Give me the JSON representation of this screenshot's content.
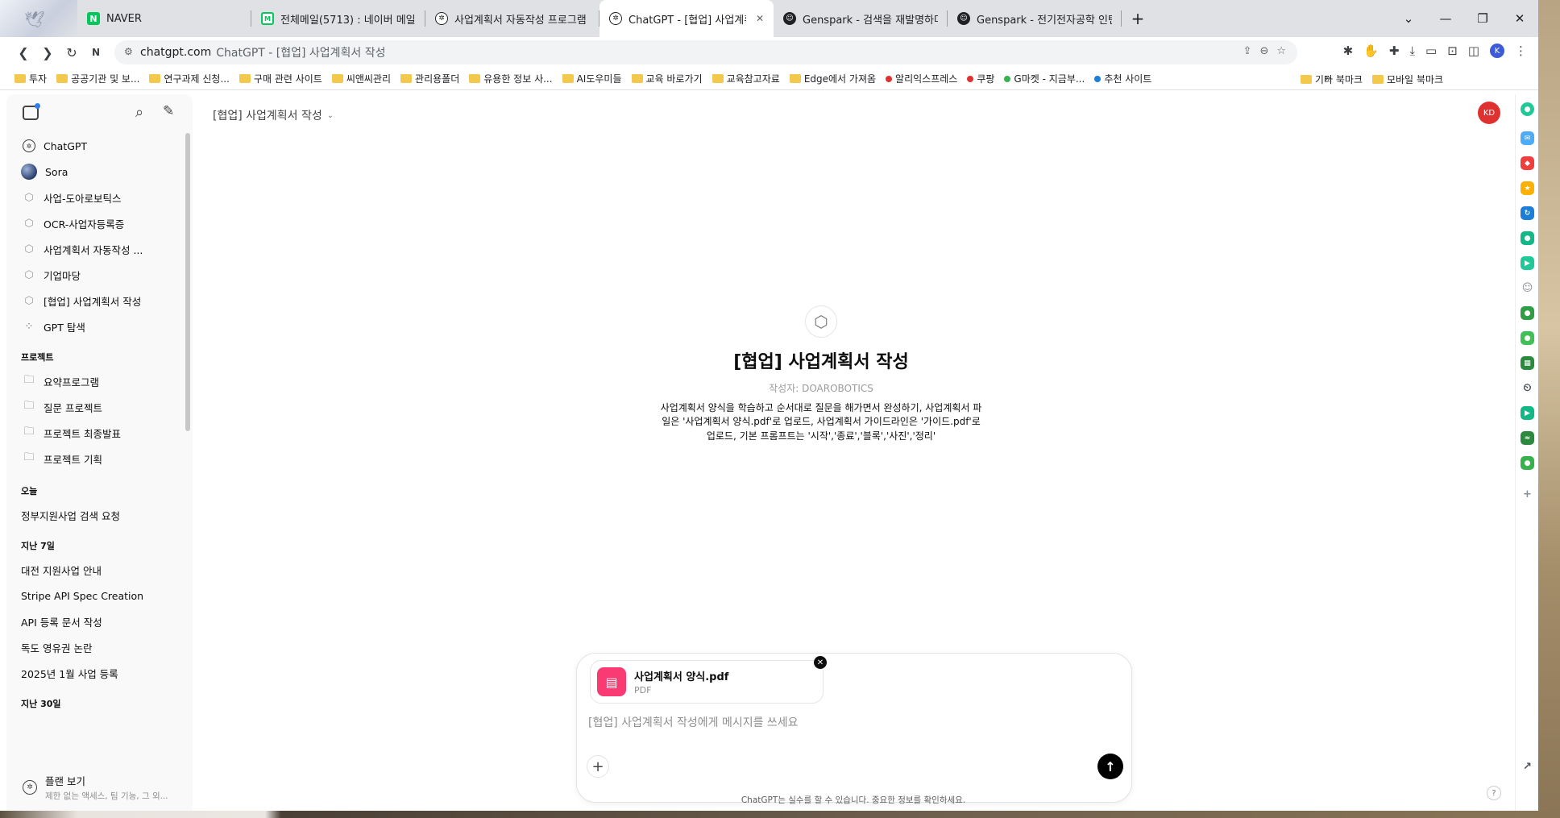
{
  "browser": {
    "tabs": [
      {
        "label": "NAVER",
        "favicon": "naver-icon",
        "active": false
      },
      {
        "label": "전체메일(5713) : 네이버 메일",
        "favicon": "mail-icon",
        "active": false
      },
      {
        "label": "사업계획서 자동작성 프로그램",
        "favicon": "chatgpt-icon",
        "active": false
      },
      {
        "label": "ChatGPT - [협업] 사업계획서",
        "favicon": "chatgpt-icon",
        "active": true
      },
      {
        "label": "Genspark - 검색을 재발명하다",
        "favicon": "genspark-icon",
        "active": false
      },
      {
        "label": "Genspark - 전기전자공학 인텐",
        "favicon": "genspark-icon",
        "active": false
      }
    ],
    "address": {
      "host": "chatgpt.com",
      "page_title": "ChatGPT - [협업] 사업계획서 작성"
    },
    "profile_initial": "K",
    "bookmarks": [
      {
        "label": "투자",
        "kind": "folder"
      },
      {
        "label": "공공기관 및 보...",
        "kind": "folder"
      },
      {
        "label": "연구과제 신청...",
        "kind": "folder"
      },
      {
        "label": "구매 관련 사이트",
        "kind": "folder"
      },
      {
        "label": "씨앤씨관리",
        "kind": "folder"
      },
      {
        "label": "관리용폴더",
        "kind": "folder"
      },
      {
        "label": "유용한 정보 사...",
        "kind": "folder"
      },
      {
        "label": "AI도우미들",
        "kind": "folder"
      },
      {
        "label": "교육 바로가기",
        "kind": "folder"
      },
      {
        "label": "교육참고자료",
        "kind": "folder"
      },
      {
        "label": "Edge에서 가져옴",
        "kind": "folder"
      },
      {
        "label": "알리익스프레스",
        "kind": "site",
        "color": "#e03131"
      },
      {
        "label": "쿠팡",
        "kind": "site",
        "color": "#e03131"
      },
      {
        "label": "G마켓 - 지금부...",
        "kind": "site",
        "color": "#37b24d"
      },
      {
        "label": "추천 사이트",
        "kind": "site",
        "color": "#1c7ed6"
      }
    ],
    "bookmarks_more": "»",
    "bookmarks_right": [
      {
        "label": "기타 북마크"
      },
      {
        "label": "모바일 북마크"
      }
    ]
  },
  "sidebar": {
    "items": [
      {
        "label": "ChatGPT",
        "icon": "chatgpt-icon"
      },
      {
        "label": "Sora",
        "icon": "sora-icon"
      },
      {
        "label": "사업-도아로보틱스",
        "icon": "cube-icon"
      },
      {
        "label": "OCR-사업자등록증",
        "icon": "cube-icon"
      },
      {
        "label": "사업계획서 자동작성 ...",
        "icon": "cube-icon"
      },
      {
        "label": "기업마당",
        "icon": "cube-icon"
      },
      {
        "label": "[협업] 사업계획서 작성",
        "icon": "cube-icon"
      },
      {
        "label": "GPT 탐색",
        "icon": "grid-icon"
      }
    ],
    "projects_title": "프로젝트",
    "projects": [
      {
        "label": "요약프로그램"
      },
      {
        "label": "질문 프로젝트"
      },
      {
        "label": "프로젝트 최종발표"
      },
      {
        "label": "프로젝트 기획"
      }
    ],
    "today_title": "오늘",
    "today": [
      {
        "label": "정부지원사업 검색 요청"
      }
    ],
    "week_title": "지난 7일",
    "week": [
      {
        "label": "대전 지원사업 안내"
      },
      {
        "label": "Stripe API Spec Creation"
      },
      {
        "label": "API 등록 문서 작성"
      },
      {
        "label": "독도 영유권 논란"
      },
      {
        "label": "2025년 1월 사업 등록"
      }
    ],
    "month_title": "지난 30일",
    "plan": {
      "title": "플랜 보기",
      "subtitle": "제한 없는 액세스, 팀 기능, 그 외..."
    }
  },
  "main": {
    "gpt_selector": "[협업] 사업계획서 작성",
    "avatar_initials": "KD",
    "hero": {
      "title": "[협업] 사업계획서 작성",
      "author": "작성자: DOAROBOTICS",
      "description": "사업계획서 양식을 학습하고 순서대로 질문을 해가면서 완성하기, 사업계획서 파일은 '사업계획서 양식.pdf'로 업로드, 사업계획서 가이드라인은 '가이드.pdf'로 업로드, 기본 프롬프트는 '시작','종료','블록','사진','정리'"
    },
    "composer": {
      "file_name": "사업계획서 양식.pdf",
      "file_type": "PDF",
      "placeholder": "[협업] 사업계획서 작성에게 메시지를 쓰세요"
    },
    "disclaimer": "ChatGPT는 실수를 할 수 있습니다. 중요한 정보를 확인하세요.",
    "help": "?"
  },
  "rail_icons": [
    {
      "name": "copilot-icon",
      "color": "#20c997"
    },
    {
      "name": "outlook-icon",
      "color": "#4dabf7"
    },
    {
      "name": "pocket-icon",
      "color": "#f03e3e"
    },
    {
      "name": "favorites-icon",
      "color": "#fab005"
    },
    {
      "name": "translate-icon",
      "color": "#1c7ed6"
    },
    {
      "name": "naver-app-icon",
      "color": "#12b886"
    },
    {
      "name": "media-icon",
      "color": "#20c997"
    },
    {
      "name": "bot-icon",
      "color": "#868e96"
    },
    {
      "name": "phone-icon",
      "color": "#2f9e44"
    },
    {
      "name": "whale-icon",
      "color": "#40c057"
    },
    {
      "name": "calendar-icon",
      "color": "#2b8a3e"
    },
    {
      "name": "clock-icon",
      "color": "#495057"
    },
    {
      "name": "play-icon",
      "color": "#12b886"
    },
    {
      "name": "stock-icon",
      "color": "#2b8a3e"
    },
    {
      "name": "store-icon",
      "color": "#37b24d"
    },
    {
      "name": "add-icon",
      "color": "#868e96"
    },
    {
      "name": "external-link-icon",
      "color": "#495057"
    }
  ]
}
